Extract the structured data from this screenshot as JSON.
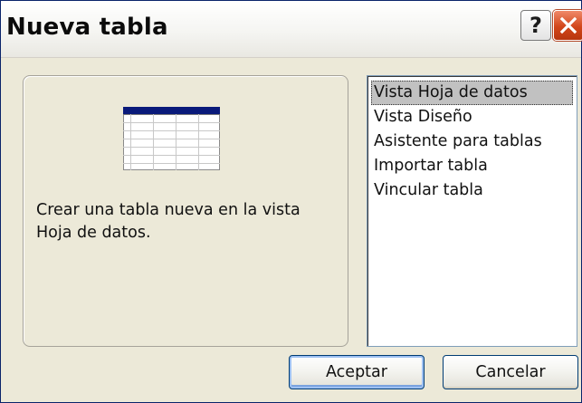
{
  "window": {
    "title": "Nueva tabla",
    "help_label": "?"
  },
  "preview": {
    "icon": "datasheet-table-icon",
    "description": "Crear una tabla nueva en la vista Hoja de datos."
  },
  "options": {
    "selected_index": 0,
    "items": [
      {
        "label": "Vista Hoja de datos"
      },
      {
        "label": "Vista Diseño"
      },
      {
        "label": "Asistente para tablas"
      },
      {
        "label": "Importar tabla"
      },
      {
        "label": "Vincular tabla"
      }
    ]
  },
  "buttons": {
    "accept_label": "Aceptar",
    "cancel_label": "Cancelar"
  },
  "colors": {
    "title_bar": "#ffffff",
    "dialog_bg": "#ece9d8",
    "close_button": "#d2461a",
    "selection_bg": "#c1c1c1",
    "table_header": "#0a1a7a"
  }
}
